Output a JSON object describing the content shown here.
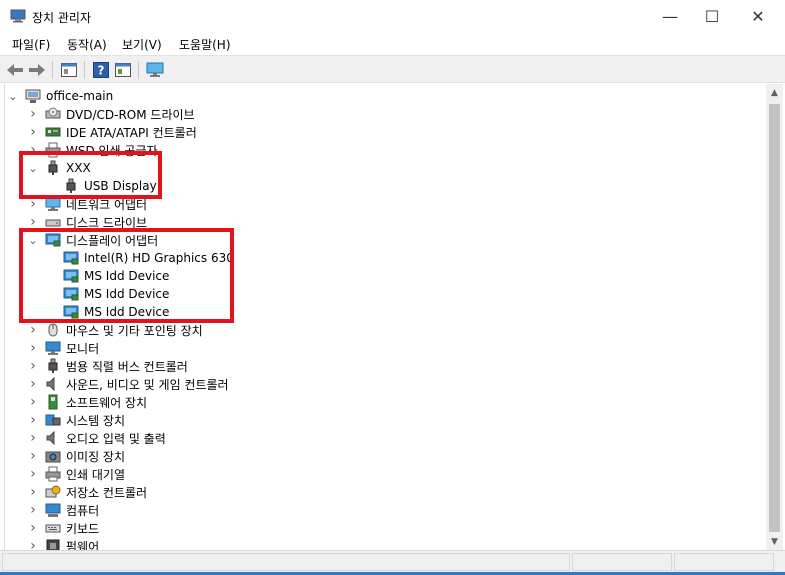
{
  "window": {
    "title": "장치 관리자",
    "minimize_glyph": "—",
    "maximize_glyph": "☐",
    "close_glyph": "✕"
  },
  "menu": [
    "파일(F)",
    "동작(A)",
    "보기(V)",
    "도움말(H)"
  ],
  "toolbar": {
    "buttons": [
      "back-icon",
      "forward-icon",
      "properties-icon",
      "help-icon",
      "details-icon",
      "monitor-scan-icon"
    ]
  },
  "tree": {
    "root": "office-main",
    "rows": [
      {
        "label": "DVD/CD-ROM 드라이브",
        "expanded": false,
        "icon": "dvd-icon",
        "depth": 1
      },
      {
        "label": "IDE ATA/ATAPI 컨트롤러",
        "expanded": false,
        "icon": "ide-controller-icon",
        "depth": 1
      },
      {
        "label": "WSD 인쇄 공급자",
        "expanded": false,
        "icon": "printer-icon",
        "depth": 1
      },
      {
        "label": "XXX",
        "expanded": true,
        "icon": "usb-plug-icon",
        "depth": 1
      },
      {
        "label": "USB Display",
        "expanded": null,
        "icon": "usb-plug-icon",
        "depth": 2
      },
      {
        "label": "네트워크 어댑터",
        "expanded": false,
        "icon": "network-adapter-icon",
        "depth": 1
      },
      {
        "label": "디스크 드라이브",
        "expanded": false,
        "icon": "disk-drive-icon",
        "depth": 1
      },
      {
        "label": "디스플레이 어댑터",
        "expanded": true,
        "icon": "display-adapter-icon",
        "depth": 1
      },
      {
        "label": "Intel(R) HD Graphics 630",
        "expanded": null,
        "icon": "display-adapter-icon",
        "depth": 2
      },
      {
        "label": "MS Idd Device",
        "expanded": null,
        "icon": "display-adapter-icon",
        "depth": 2
      },
      {
        "label": "MS Idd Device",
        "expanded": null,
        "icon": "display-adapter-icon",
        "depth": 2
      },
      {
        "label": "MS Idd Device",
        "expanded": null,
        "icon": "display-adapter-icon",
        "depth": 2
      },
      {
        "label": "마우스 및 기타 포인팅 장치",
        "expanded": false,
        "icon": "mouse-icon",
        "depth": 1
      },
      {
        "label": "모니터",
        "expanded": false,
        "icon": "monitor-icon",
        "depth": 1
      },
      {
        "label": "범용 직렬 버스 컨트롤러",
        "expanded": false,
        "icon": "usb-plug-icon",
        "depth": 1
      },
      {
        "label": "사운드, 비디오 및 게임 컨트롤러",
        "expanded": false,
        "icon": "speaker-icon",
        "depth": 1
      },
      {
        "label": "소프트웨어 장치",
        "expanded": false,
        "icon": "software-device-icon",
        "depth": 1
      },
      {
        "label": "시스템 장치",
        "expanded": false,
        "icon": "system-device-icon",
        "depth": 1
      },
      {
        "label": "오디오 입력 및 출력",
        "expanded": false,
        "icon": "speaker-icon",
        "depth": 1
      },
      {
        "label": "이미징 장치",
        "expanded": false,
        "icon": "camera-icon",
        "depth": 1
      },
      {
        "label": "인쇄 대기열",
        "expanded": false,
        "icon": "printer-icon",
        "depth": 1
      },
      {
        "label": "저장소 컨트롤러",
        "expanded": false,
        "icon": "storage-controller-icon",
        "depth": 1
      },
      {
        "label": "컴퓨터",
        "expanded": false,
        "icon": "computer-icon",
        "depth": 1
      },
      {
        "label": "키보드",
        "expanded": false,
        "icon": "keyboard-icon",
        "depth": 1
      },
      {
        "label": "펌웨어",
        "expanded": false,
        "icon": "firmware-icon",
        "depth": 1
      }
    ]
  },
  "colors": {
    "highlight_box": "#e2131b",
    "accent": "#2b78c5"
  }
}
